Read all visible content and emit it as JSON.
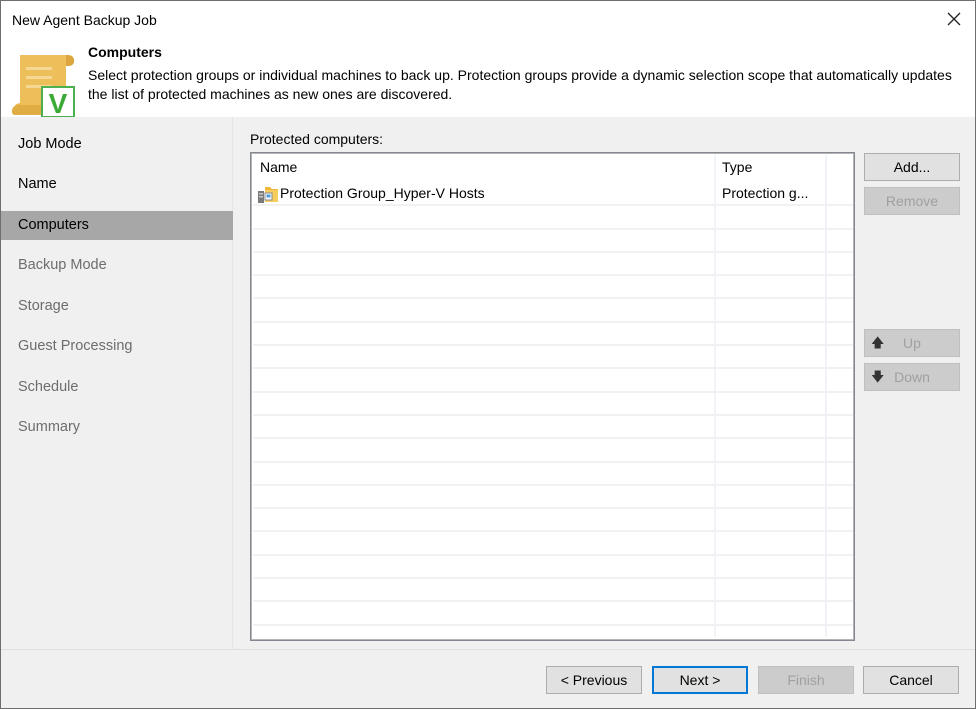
{
  "window": {
    "title": "New Agent Backup Job",
    "close_icon": "close-icon"
  },
  "header": {
    "icon": "scroll-with-veeam-v-icon",
    "title": "Computers",
    "description": "Select protection groups or individual machines to back up. Protection groups provide a dynamic selection scope that automatically updates the list of protected machines as new ones are discovered."
  },
  "sidebar": {
    "items": [
      {
        "label": "Job Mode",
        "state": "completed"
      },
      {
        "label": "Name",
        "state": "completed"
      },
      {
        "label": "Computers",
        "state": "active"
      },
      {
        "label": "Backup Mode",
        "state": "disabled"
      },
      {
        "label": "Storage",
        "state": "disabled"
      },
      {
        "label": "Guest Processing",
        "state": "disabled"
      },
      {
        "label": "Schedule",
        "state": "disabled"
      },
      {
        "label": "Summary",
        "state": "disabled"
      }
    ]
  },
  "main": {
    "list_label": "Protected computers:",
    "columns": [
      "Name",
      "Type"
    ],
    "rows": [
      {
        "name": "Protection Group_Hyper-V Hosts",
        "type": "Protection g...",
        "icon": "protection-group-icon"
      }
    ],
    "buttons": {
      "add": "Add...",
      "remove": "Remove",
      "up": "Up",
      "down": "Down"
    }
  },
  "footer": {
    "previous": "< Previous",
    "next": "Next >",
    "finish": "Finish",
    "cancel": "Cancel"
  },
  "colors": {
    "accent": "#0078d7",
    "active_nav": "#a7a7a7",
    "icon_gold": "#e8b64c",
    "icon_green": "#3aa935"
  }
}
